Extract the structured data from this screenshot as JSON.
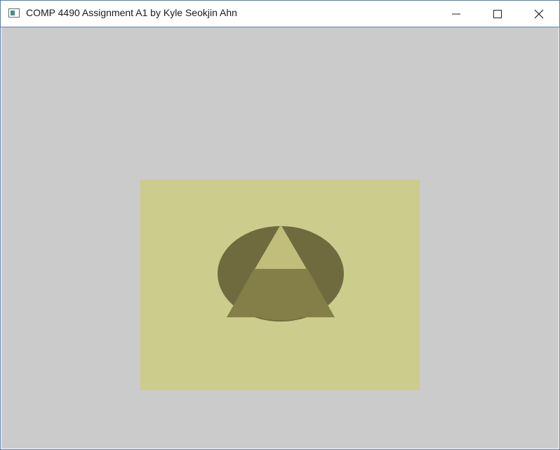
{
  "window": {
    "title": "COMP 4490 Assignment A1 by Kyle Seokjin Ahn",
    "app_icon": "app-window-icon",
    "controls": [
      "minimize-icon",
      "maximize-icon",
      "close-icon"
    ]
  },
  "scene": {
    "background_color": "#cbcbcb",
    "viewport_color": "#cccc8d",
    "ellipse_color": "#6f6b3e",
    "triangle_upper_color": "#c1bd7a",
    "triangle_lower_color": "#847f48"
  }
}
